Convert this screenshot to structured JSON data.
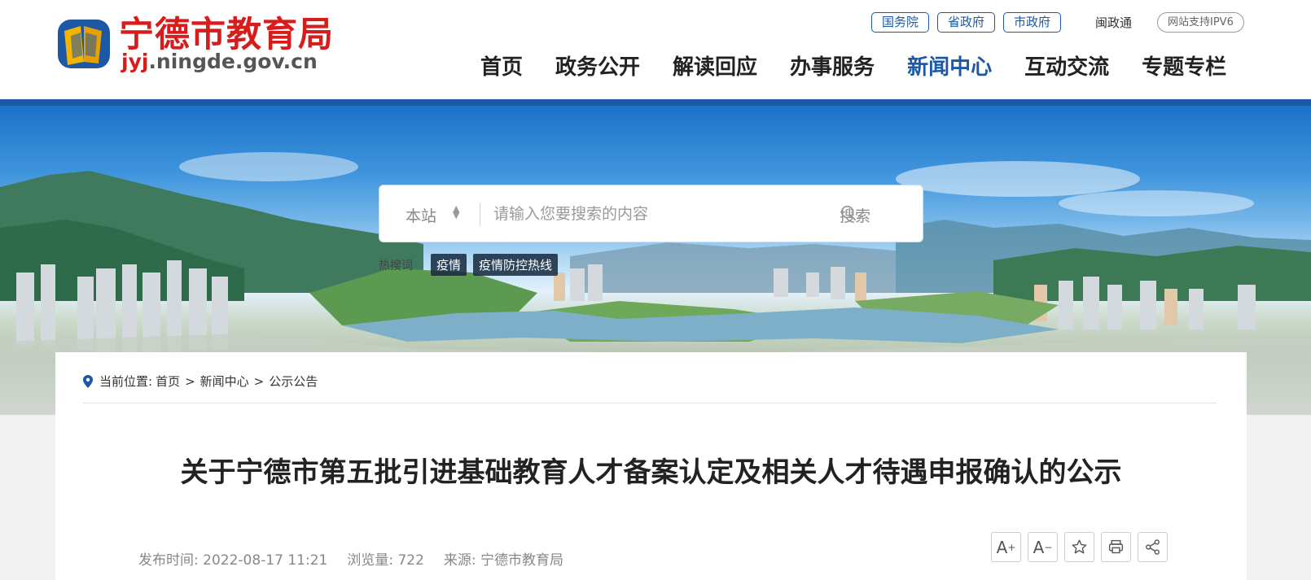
{
  "site": {
    "title": "宁德市教育局",
    "domain_hl": "jyj",
    "domain_rest": ".ningde.gov.cn"
  },
  "top_links": [
    "国务院",
    "省政府",
    "市政府"
  ],
  "mzt": "闽政通",
  "ipv6": "网站支持IPV6",
  "nav": [
    {
      "label": "首页",
      "active": false
    },
    {
      "label": "政务公开",
      "active": false
    },
    {
      "label": "解读回应",
      "active": false
    },
    {
      "label": "办事服务",
      "active": false
    },
    {
      "label": "新闻中心",
      "active": true
    },
    {
      "label": "互动交流",
      "active": false
    },
    {
      "label": "专题专栏",
      "active": false
    }
  ],
  "search": {
    "scope": "本站",
    "placeholder": "请输入您要搜索的内容",
    "button": "搜索"
  },
  "hot": {
    "label": "热搜词",
    "tags": [
      "疫情",
      "疫情防控热线"
    ]
  },
  "breadcrumb": {
    "prefix": "当前位置:",
    "items": [
      "首页",
      "新闻中心",
      "公示公告"
    ]
  },
  "article": {
    "title": "关于宁德市第五批引进基础教育人才备案认定及相关人才待遇申报确认的公示",
    "publish": "发布时间: 2022-08-17 11:21",
    "views": "浏览量:  722",
    "source": "来源:  宁德市教育局"
  },
  "tools": [
    "font-increase-icon",
    "font-decrease-icon",
    "star-icon",
    "print-icon",
    "share-icon"
  ],
  "colors": {
    "brand_red": "#d71c1c",
    "brand_blue": "#1d58a7"
  }
}
